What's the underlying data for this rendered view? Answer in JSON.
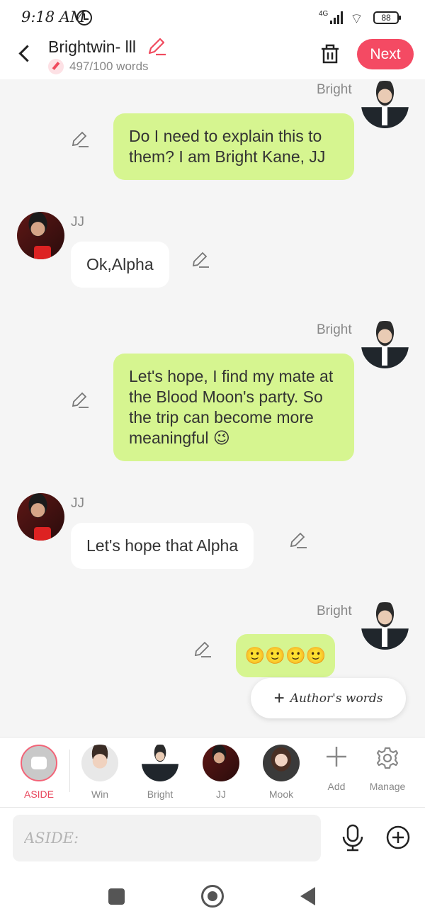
{
  "status": {
    "time": "9:18 AM",
    "network": "4G",
    "battery": "88"
  },
  "header": {
    "title": "Brightwin- lll",
    "word_count": "497/100 words",
    "next_label": "Next"
  },
  "messages": [
    {
      "sender": "Bright",
      "text": "Do I need to explain this to them? I am Bright Kane, JJ"
    },
    {
      "sender": "JJ",
      "text": "Ok,Alpha"
    },
    {
      "sender": "Bright",
      "text": "Let's hope, I find my mate at the Blood Moon's party. So the trip can become more meaningful 😉"
    },
    {
      "sender": "JJ",
      "text": "Let's hope that Alpha"
    },
    {
      "sender": "Bright",
      "text": "🙂🙂🙂🙂"
    }
  ],
  "author_words": {
    "plus": "+",
    "label": "Author's words"
  },
  "characters": [
    {
      "label": "ASIDE",
      "color": "#e8485e"
    },
    {
      "label": "Win"
    },
    {
      "label": "Bright"
    },
    {
      "label": "JJ"
    },
    {
      "label": "Mook"
    }
  ],
  "tools": {
    "add_label": "Add",
    "manage_label": "Manage"
  },
  "input": {
    "placeholder": "ASIDE:"
  },
  "icons": [
    "back-icon",
    "pencil-icon",
    "trash-icon",
    "plus-icon",
    "gear-icon",
    "microphone-icon",
    "add-circle-icon"
  ]
}
